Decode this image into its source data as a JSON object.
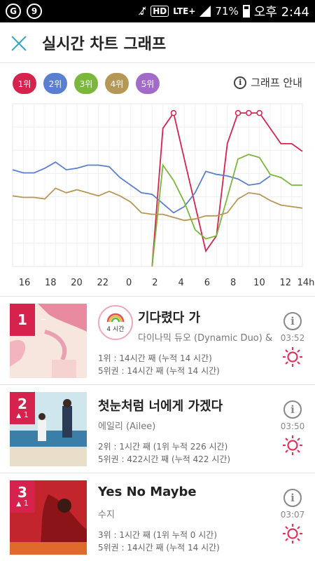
{
  "status": {
    "battery": "71%",
    "time": "오후 2:44",
    "hd": "HD",
    "lte": "LTE+"
  },
  "header": {
    "title": "실시간 차트 그래프"
  },
  "legend": [
    {
      "label": "1위",
      "color": "#d6234e"
    },
    {
      "label": "2위",
      "color": "#5b7fd0"
    },
    {
      "label": "3위",
      "color": "#7ab73a"
    },
    {
      "label": "4위",
      "color": "#b69856"
    },
    {
      "label": "5위",
      "color": "#a36bc8"
    }
  ],
  "guide": {
    "label": "그래프 안내"
  },
  "chart_data": {
    "type": "line",
    "x": [
      "16",
      "18",
      "20",
      "22",
      "0",
      "2",
      "4",
      "6",
      "8",
      "10",
      "12",
      "14h"
    ],
    "series": [
      {
        "color": "#d6234e",
        "points": [
          null,
          null,
          null,
          null,
          null,
          null,
          null,
          null,
          null,
          null,
          null,
          null,
          null,
          0,
          9,
          10,
          7,
          4,
          1,
          2,
          8,
          10,
          10,
          10,
          9,
          8,
          8,
          7.5
        ]
      },
      {
        "color": "#5b7fd0",
        "points": [
          6.3,
          6.1,
          6.1,
          6.4,
          6.8,
          6.3,
          6.4,
          6.6,
          6.6,
          6.5,
          5.8,
          5.3,
          4.8,
          4.7,
          4.1,
          3.5,
          3.9,
          4.8,
          6.2,
          6.0,
          5.9,
          5.7,
          5.3,
          5.4,
          5.9
        ]
      },
      {
        "color": "#7ab73a",
        "points": [
          null,
          null,
          null,
          null,
          null,
          null,
          null,
          null,
          null,
          null,
          null,
          null,
          null,
          0,
          6.6,
          5.6,
          4.2,
          2.4,
          1.8,
          2.0,
          4.5,
          7.0,
          7.3,
          7.1,
          6.0,
          5.8,
          5.3,
          5.3
        ]
      },
      {
        "color": "#b69856",
        "points": [
          4.6,
          4.5,
          4.5,
          4.4,
          5.1,
          4.8,
          5.0,
          4.8,
          4.6,
          4.9,
          4.6,
          4.2,
          3.5,
          3.4,
          3.4,
          3.2,
          3.0,
          3.1,
          3.3,
          3.3,
          3.5,
          4.4,
          4.8,
          4.7,
          4.3,
          4.0,
          3.9,
          3.8
        ]
      }
    ]
  },
  "items": [
    {
      "rank": "1",
      "change": "–",
      "song": "기다렸다 가",
      "artist": "다이나믹 듀오 (Dynamic Duo) & ...",
      "stat1": "1위 : 14시간 째 (누적 14 시간)",
      "stat2": "5위권 : 14시간 째 (누적 14 시간)",
      "duration": "03:52",
      "badge": "4 시간"
    },
    {
      "rank": "2",
      "change": "1",
      "song": "첫눈처럼 너에게 가겠다",
      "artist": "에일리 (Ailee)",
      "stat1": "2위 : 1시간 째 (1위 누적 226 시간)",
      "stat2": "5위권 : 422시간 째 (누적 422 시간)",
      "duration": "03:50"
    },
    {
      "rank": "3",
      "change": "1",
      "song": "Yes No Maybe",
      "artist": "수지",
      "stat1": "3위 : 1시간 째 (1위 누적 0 시간)",
      "stat2": "5위권 : 14시간 째 (누적 14 시간)",
      "duration": "03:07"
    }
  ]
}
